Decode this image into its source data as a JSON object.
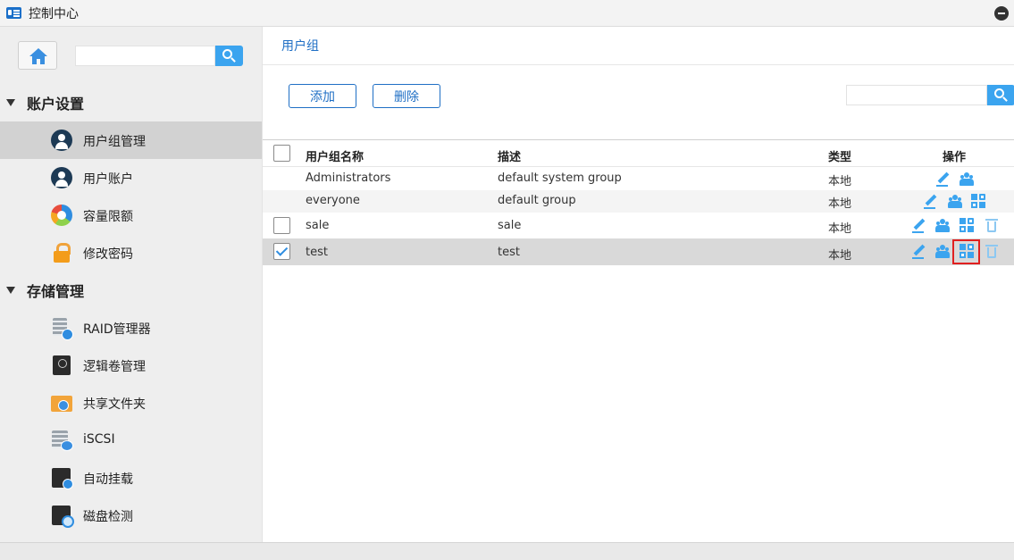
{
  "window": {
    "title": "控制中心"
  },
  "sidebar": {
    "search": {
      "placeholder": ""
    },
    "sections": [
      {
        "label": "账户设置",
        "items": [
          {
            "label": "用户组管理",
            "icon": "user-group-icon",
            "active": true
          },
          {
            "label": "用户账户",
            "icon": "user-account-icon",
            "active": false
          },
          {
            "label": "容量限额",
            "icon": "quota-pie-icon",
            "active": false
          },
          {
            "label": "修改密码",
            "icon": "lock-icon",
            "active": false
          }
        ]
      },
      {
        "label": "存储管理",
        "items": [
          {
            "label": "RAID管理器",
            "icon": "raid-icon",
            "active": false
          },
          {
            "label": "逻辑卷管理",
            "icon": "logical-volume-icon",
            "active": false
          },
          {
            "label": "共享文件夹",
            "icon": "shared-folder-icon",
            "active": false
          },
          {
            "label": "iSCSI",
            "icon": "iscsi-icon",
            "active": false
          },
          {
            "label": "自动挂载",
            "icon": "auto-mount-icon",
            "active": false
          },
          {
            "label": "磁盘检测",
            "icon": "disk-check-icon",
            "active": false
          }
        ]
      }
    ]
  },
  "main": {
    "breadcrumb": "用户组",
    "toolbar": {
      "add_label": "添加",
      "delete_label": "删除",
      "search_placeholder": ""
    },
    "table": {
      "columns": [
        "用户组名称",
        "描述",
        "类型",
        "操作"
      ],
      "rows": [
        {
          "name": "Administrators",
          "description": "default system group",
          "type": "本地",
          "checkbox": false,
          "actions": [
            "edit",
            "members"
          ]
        },
        {
          "name": "everyone",
          "description": "default group",
          "type": "本地",
          "checkbox": false,
          "actions": [
            "edit",
            "members",
            "permissions"
          ]
        },
        {
          "name": "sale",
          "description": "sale",
          "type": "本地",
          "checkbox": true,
          "checked": false,
          "actions": [
            "edit",
            "members",
            "permissions",
            "delete"
          ]
        },
        {
          "name": "test",
          "description": "test",
          "type": "本地",
          "checkbox": true,
          "checked": true,
          "actions": [
            "edit",
            "members",
            "permissions",
            "delete"
          ]
        }
      ]
    }
  },
  "colors": {
    "accent": "#1f6fc5",
    "search_button": "#3ba4ef",
    "highlight": "#e02020",
    "selected_row": "#d9d9d9"
  }
}
